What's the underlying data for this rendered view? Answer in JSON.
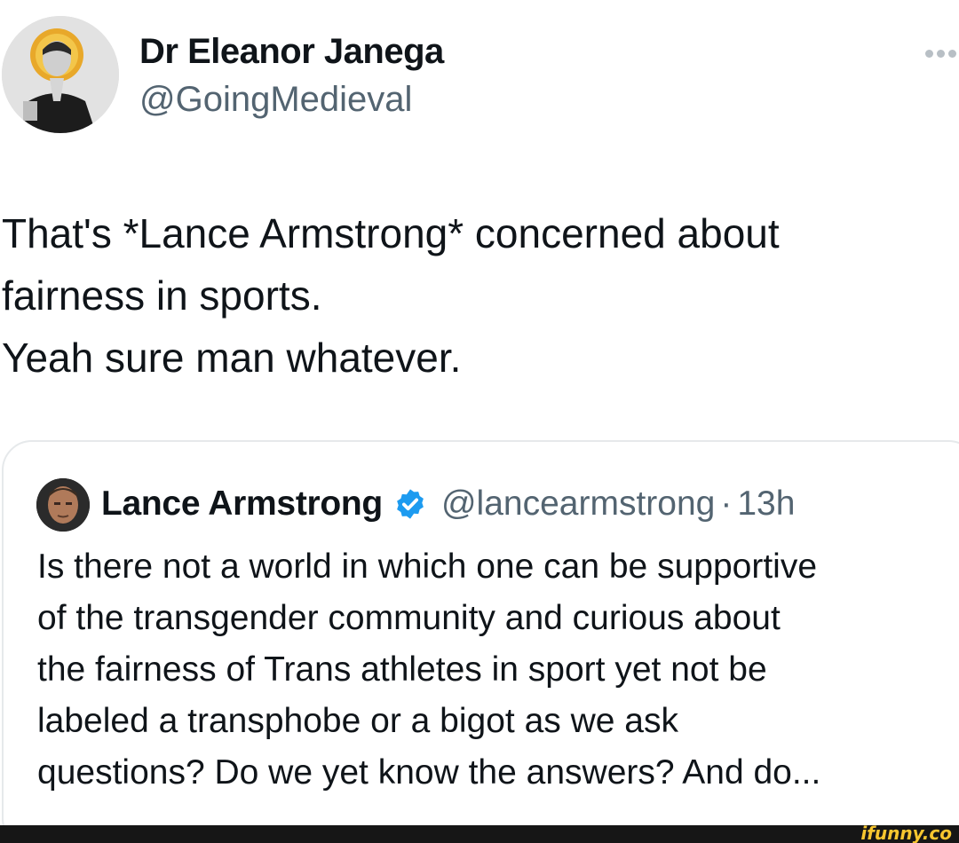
{
  "tweet": {
    "author": {
      "display_name": "Dr Eleanor Janega",
      "handle": "@GoingMedieval"
    },
    "text_lines": [
      "That's *Lance Armstrong* concerned about",
      "fairness in sports.",
      "Yeah sure man whatever."
    ],
    "more_icon": "ellipsis-icon"
  },
  "quote": {
    "author": {
      "display_name": "Lance Armstrong",
      "handle": "@lancearmstrong",
      "verified": true
    },
    "separator": "·",
    "time": "13h",
    "text_lines": [
      "Is there not a world in which one can be supportive",
      "of the transgender community and curious about",
      "the fairness of Trans athletes in sport yet not be",
      "labeled a transphobe or a bigot as we ask",
      "questions? Do we yet know the answers? And do..."
    ]
  },
  "watermark": {
    "text": "ifunny.co"
  },
  "colors": {
    "verified": "#1d9bf0",
    "secondary_text": "#536471",
    "border": "#e6e9eb",
    "watermark": "#f7c62f"
  }
}
